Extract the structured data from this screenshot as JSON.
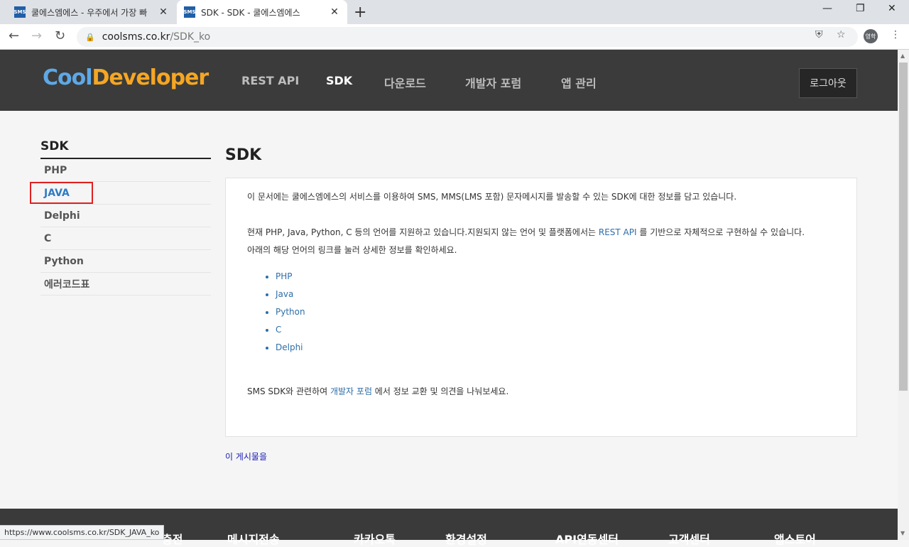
{
  "browser": {
    "tabs": [
      {
        "title": "쿨에스엠에스 - 우주에서 가장 빠",
        "favicon": "SMS"
      },
      {
        "title": "SDK - SDK - 쿨에스엠에스",
        "favicon": "SMS"
      }
    ],
    "url_domain": "coolsms.co.kr",
    "url_path": "/SDK_ko",
    "profile_label": "영학",
    "status_url": "https://www.coolsms.co.kr/SDK_JAVA_ko"
  },
  "header": {
    "logo_part1": "Cool",
    "logo_part2": "Developer",
    "nav": [
      "REST API",
      "SDK",
      "다운로드",
      "개발자 포럼",
      "앱 관리"
    ],
    "active_nav": "SDK",
    "logout_label": "로그아웃"
  },
  "sidebar": {
    "title": "SDK",
    "items": [
      {
        "label": "PHP"
      },
      {
        "label": "JAVA"
      },
      {
        "label": "Delphi"
      },
      {
        "label": "C"
      },
      {
        "label": "Python"
      },
      {
        "label": "에러코드표"
      }
    ],
    "selected": "JAVA"
  },
  "main": {
    "title": "SDK",
    "intro": "이 문서에는 쿨에스엠에스의 서비스를 이용하여 SMS, MMS(LMS 포함) 문자메시지를 발송할 수 있는 SDK에 대한 정보를 담고 있습니다.",
    "support_before": "현재 PHP, Java, Python, C 등의  언어를 지원하고 있습니다.지원되지 않는 언어 및 플랫폼에서는 ",
    "support_link": "REST API",
    "support_after": " 를 기반으로 자체적으로 구현하실 수 있습니다.",
    "guide": "아래의 해당 언어의 링크를 눌러 상세한 정보를 확인하세요.",
    "languages": [
      "PHP",
      "Java",
      "Python",
      "C",
      "Delphi"
    ],
    "forum_before": "SMS SDK와 관련하여 ",
    "forum_link": "개발자 포럼",
    "forum_after": " 에서 정보 교환 및 의견을  나눠보세요.",
    "post_link": "이 게시물을"
  },
  "footer": {
    "items": [
      "충전",
      "메시지전송",
      "카카오톡",
      "환경설정",
      "API연동센터",
      "고객센터",
      "앱스토어"
    ]
  }
}
